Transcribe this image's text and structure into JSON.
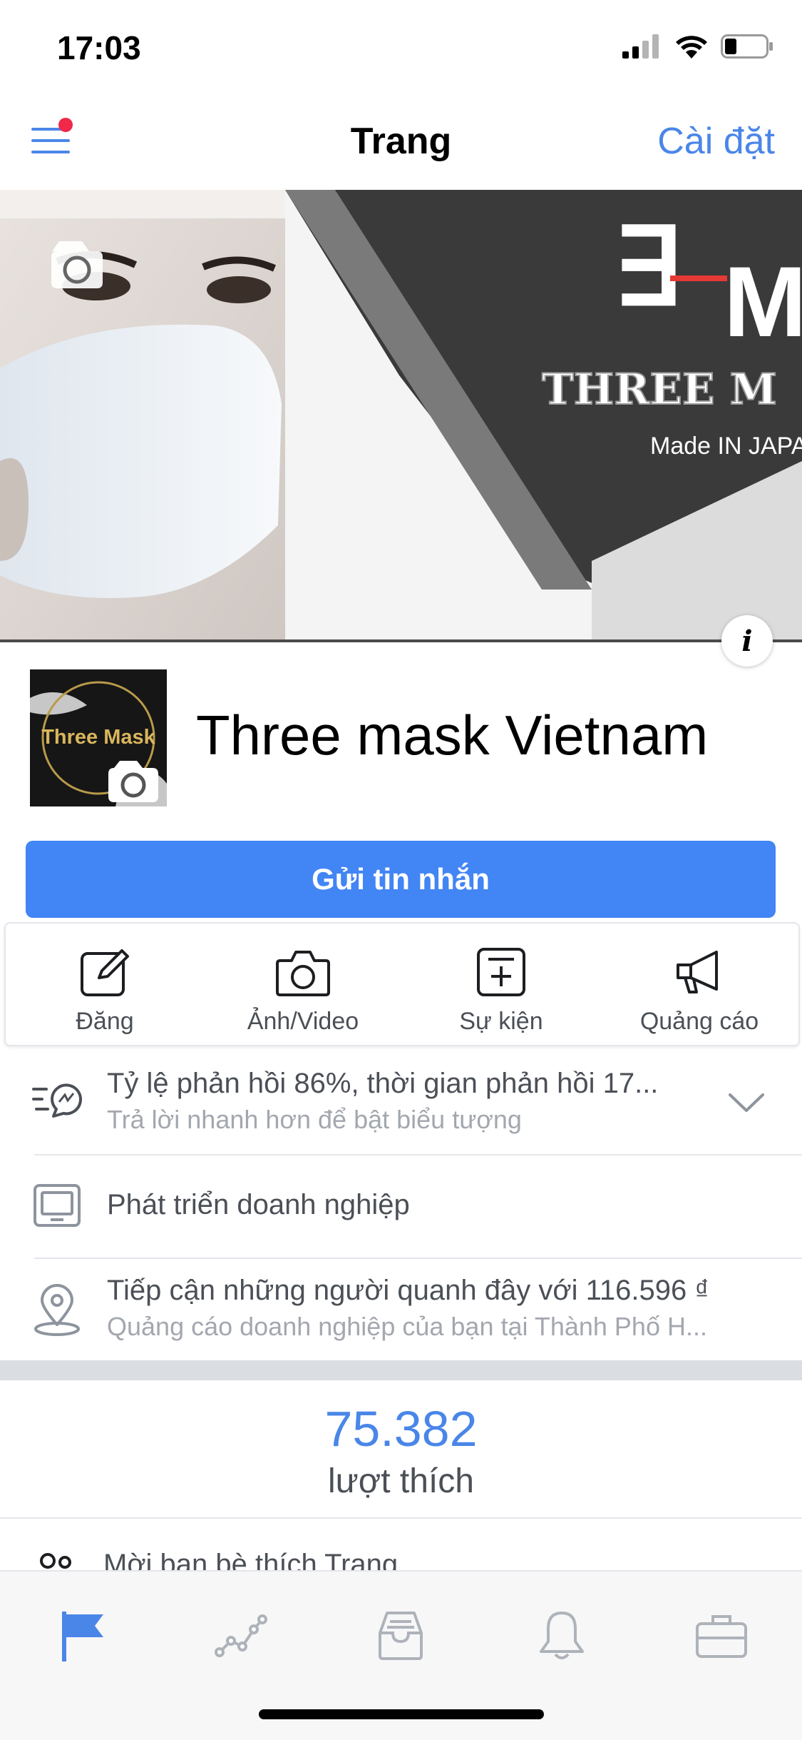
{
  "status": {
    "time": "17:03"
  },
  "nav": {
    "title": "Trang",
    "settings": "Cài đặt"
  },
  "cover": {
    "brand_line": "THREE M",
    "brand_tag": "Made IN JAPAN"
  },
  "profile": {
    "logo_text": "Three Mask",
    "page_name": "Three mask Vietnam"
  },
  "message_button": "Gửi tin nhắn",
  "actions": [
    {
      "label": "Đăng",
      "icon": "edit-icon"
    },
    {
      "label": "Ảnh/Video",
      "icon": "camera-icon"
    },
    {
      "label": "Sự kiện",
      "icon": "calendar-plus-icon"
    },
    {
      "label": "Quảng cáo",
      "icon": "megaphone-icon"
    }
  ],
  "info_rows": {
    "response": {
      "title": "Tỷ lệ phản hồi 86%, thời gian phản hồi 17...",
      "subtitle": "Trả lời nhanh hơn để bật biểu tượng"
    },
    "grow": {
      "title": "Phát triển doanh nghiệp"
    },
    "reach": {
      "title": "Tiếp cận những người quanh đây với 116.596 ₫",
      "subtitle": "Quảng cáo doanh nghiệp của bạn tại Thành Phố H..."
    }
  },
  "likes": {
    "count": "75.382",
    "label": "lượt thích"
  },
  "invite": "Mời bạn bè thích Trang",
  "tabs": [
    "flag-icon",
    "insights-icon",
    "inbox-icon",
    "bell-icon",
    "briefcase-icon"
  ],
  "colors": {
    "accent": "#4285f4",
    "link": "#4a86e8",
    "badge": "#f02849"
  }
}
